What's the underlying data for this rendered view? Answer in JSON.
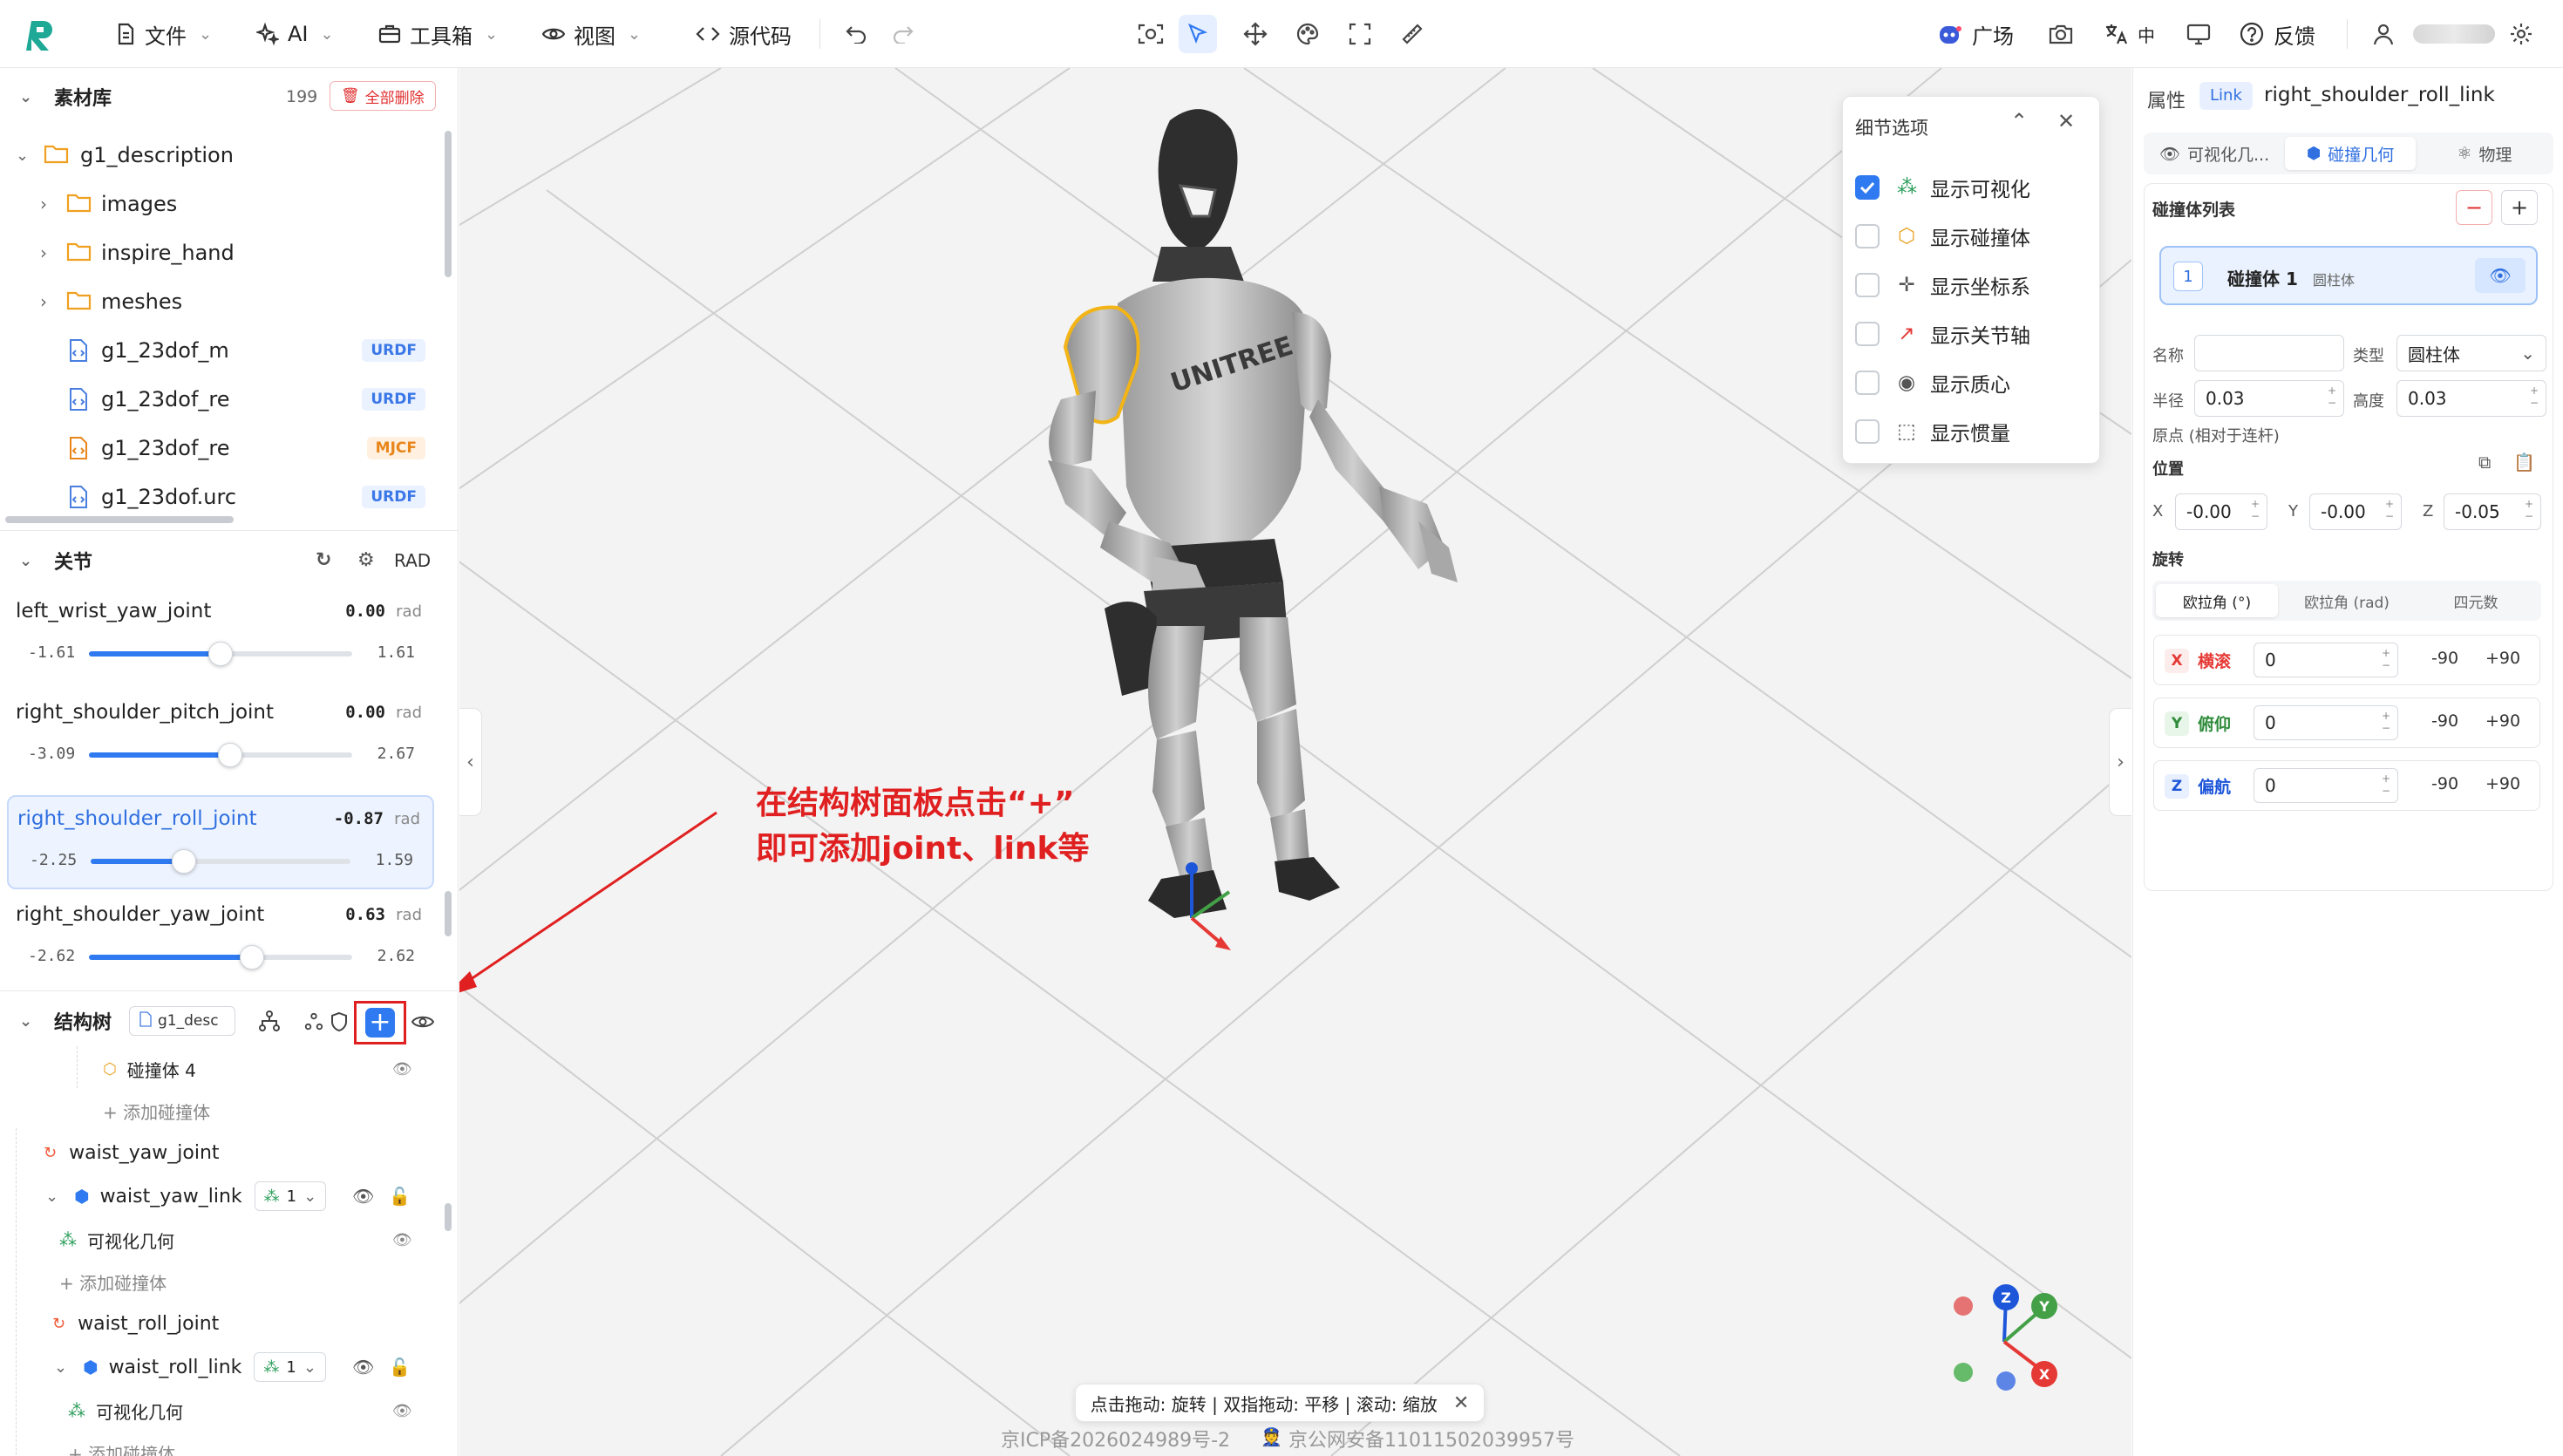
{
  "toolbar": {
    "file": "文件",
    "ai": "AI",
    "toolbox": "工具箱",
    "view": "视图",
    "source": "源代码",
    "plaza": "广场",
    "lang": "中",
    "feedback": "反馈"
  },
  "assets": {
    "title": "素材库",
    "count": "199",
    "delete_all": "全部删除",
    "items": [
      {
        "name": "g1_description"
      },
      {
        "name": "images"
      },
      {
        "name": "inspire_hand"
      },
      {
        "name": "meshes"
      },
      {
        "name": "g1_23dof_m",
        "badge": "URDF"
      },
      {
        "name": "g1_23dof_re",
        "badge": "URDF"
      },
      {
        "name": "g1_23dof_re",
        "badge": "MJCF"
      },
      {
        "name": "g1_23dof.urc",
        "badge": "URDF"
      }
    ]
  },
  "joints": {
    "title": "关节",
    "unit_toggle": "RAD",
    "items": [
      {
        "name": "left_wrist_yaw_joint",
        "value": "0.00",
        "unit": "rad",
        "min": "-1.61",
        "max": "1.61",
        "fraction": 0.5
      },
      {
        "name": "right_shoulder_pitch_joint",
        "value": "0.00",
        "unit": "rad",
        "min": "-3.09",
        "max": "2.67",
        "fraction": 0.536
      },
      {
        "name": "right_shoulder_roll_joint",
        "value": "-0.87",
        "unit": "rad",
        "min": "-2.25",
        "max": "1.59",
        "fraction": 0.36
      },
      {
        "name": "right_shoulder_yaw_joint",
        "value": "0.63",
        "unit": "rad",
        "min": "-2.62",
        "max": "2.62",
        "fraction": 0.62
      }
    ]
  },
  "structure": {
    "title": "结构树",
    "file": "g1_desc",
    "rows": [
      {
        "label": "碰撞体 4"
      },
      {
        "label": "+ 添加碰撞体"
      },
      {
        "label": "waist_yaw_joint"
      },
      {
        "label": "waist_yaw_link",
        "count": "1"
      },
      {
        "label": "可视化几何"
      },
      {
        "label": "+ 添加碰撞体"
      },
      {
        "label": "waist_roll_joint"
      },
      {
        "label": "waist_roll_link",
        "count": "1"
      },
      {
        "label": "可视化几何"
      },
      {
        "label": "+ 添加碰撞体"
      }
    ]
  },
  "details": {
    "title": "细节选项",
    "options": [
      {
        "label": "显示可视化",
        "checked": true
      },
      {
        "label": "显示碰撞体",
        "checked": false
      },
      {
        "label": "显示坐标系",
        "checked": false
      },
      {
        "label": "显示关节轴",
        "checked": false
      },
      {
        "label": "显示质心",
        "checked": false
      },
      {
        "label": "显示惯量",
        "checked": false
      }
    ]
  },
  "annotation": {
    "line1": "在结构树面板点击“+”",
    "line2": "即可添加joint、link等"
  },
  "logo_text": "UNITREE",
  "properties": {
    "title": "属性",
    "type_badge": "Link",
    "link_name": "right_shoulder_roll_link",
    "tabs": [
      "可视化几...",
      "碰撞几何",
      "物理"
    ],
    "collision_list_title": "碰撞体列表",
    "collision_item": {
      "index": "1",
      "name": "碰撞体 1",
      "shape": "圆柱体"
    },
    "name_label": "名称",
    "type_label": "类型",
    "type_value": "圆柱体",
    "radius_label": "半径",
    "radius_value": "0.03",
    "height_label": "高度",
    "height_value": "0.03",
    "origin_label": "原点 (相对于连杆)",
    "position_label": "位置",
    "pos": {
      "x_label": "X",
      "x": "-0.00",
      "y_label": "Y",
      "y": "-0.00",
      "z_label": "Z",
      "z": "-0.05"
    },
    "rotation_label": "旋转",
    "rot_tabs": [
      "欧拉角 (°)",
      "欧拉角 (rad)",
      "四元数"
    ],
    "axes": [
      {
        "tag": "X",
        "name": "横滚",
        "value": "0",
        "minus": "-90",
        "plus": "+90"
      },
      {
        "tag": "Y",
        "name": "俯仰",
        "value": "0",
        "minus": "-90",
        "plus": "+90"
      },
      {
        "tag": "Z",
        "name": "偏航",
        "value": "0",
        "minus": "-90",
        "plus": "+90"
      }
    ]
  },
  "viewport_hint": "点击拖动: 旋转 | 双指拖动: 平移 | 滚动: 缩放",
  "footer": {
    "icp": "京ICP备2026024989号-2",
    "police": "京公网安备11011502039957号"
  },
  "gizmo": {
    "x": "X",
    "y": "Y",
    "z": "Z"
  },
  "colors": {
    "accent": "#2f7af0",
    "annotation": "#e02020",
    "x_axis": "#e53935",
    "y_axis": "#43a047",
    "z_axis": "#1e56d9"
  }
}
